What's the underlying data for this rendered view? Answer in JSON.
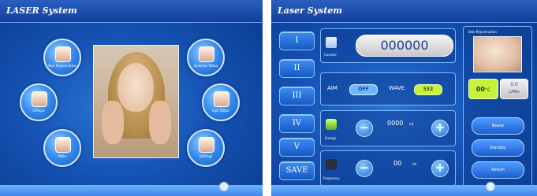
{
  "left": {
    "title": "LASER System",
    "menu": [
      {
        "icon": "face-icon",
        "label": "Skin Rejuvenation"
      },
      {
        "icon": "eyebrow-icon",
        "label": "Eyebrow Tattoo"
      },
      {
        "icon": "hands-icon",
        "label": "Lithium"
      },
      {
        "icon": "lips-icon",
        "label": "Lips Tattoo"
      },
      {
        "icon": "body-icon",
        "label": "Mole"
      },
      {
        "icon": "settings-icon",
        "label": "Settings"
      }
    ]
  },
  "right": {
    "title": "Laser System",
    "side_buttons": [
      "I",
      "II",
      "III",
      "IV",
      "V",
      "SAVE"
    ],
    "counter": {
      "label": "Counter",
      "value": "000000"
    },
    "aim": {
      "label": "AIM",
      "value": "OFF"
    },
    "wave": {
      "label": "WAVE",
      "value": "532"
    },
    "energy": {
      "label": "Energy",
      "value": "0000",
      "unit": "mJ"
    },
    "frequency": {
      "label": "Frequency",
      "value": "00",
      "unit": "Hz"
    },
    "skin": {
      "label": "Skin Rejuvenation",
      "temp": "00",
      "temp_unit": "°C",
      "flow_value": "0.0",
      "flow_unit": "L/Min",
      "buttons": [
        "Ready",
        "Standby",
        "Return"
      ]
    },
    "colors": {
      "accent_green": "#c8f23a",
      "off_blue": "#6bb8ff"
    }
  }
}
